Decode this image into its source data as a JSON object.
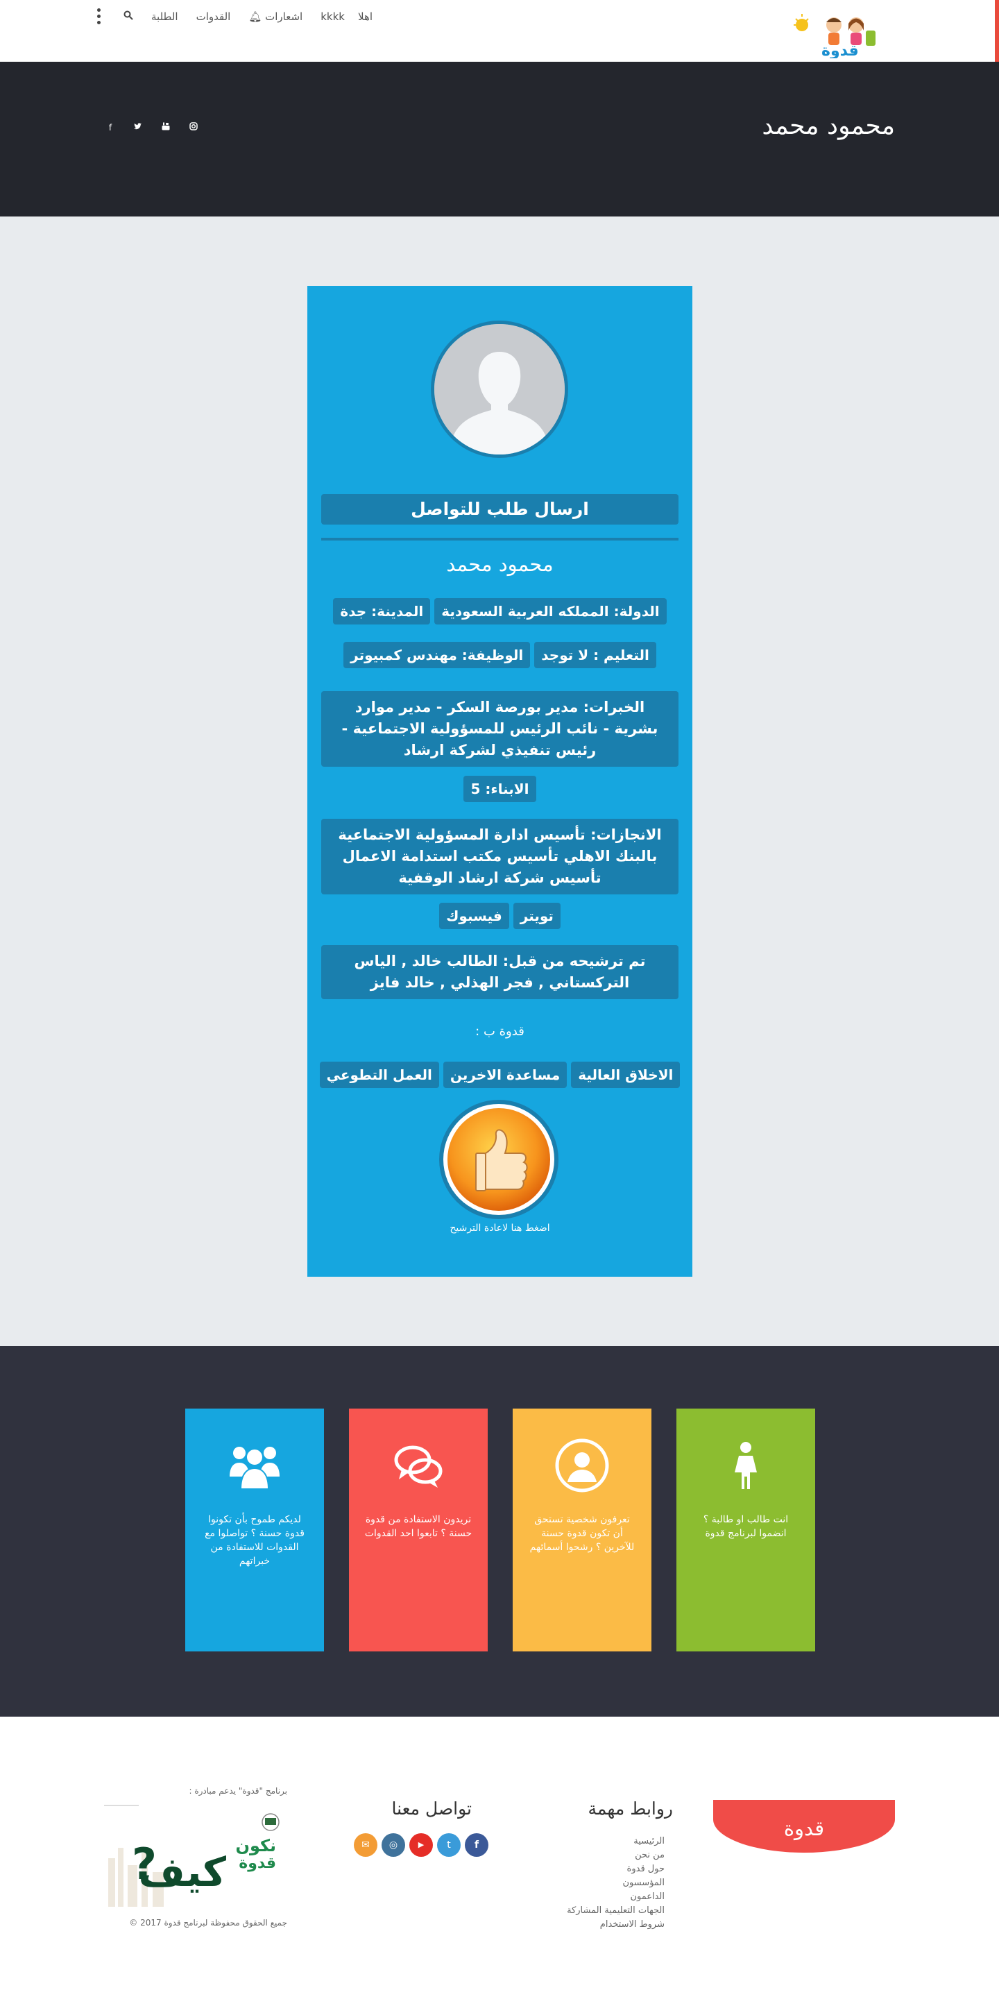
{
  "header": {
    "nav": {
      "search_icon": "search-icon",
      "students": "الطلبة",
      "role_models": "القدوات",
      "notifications": "اشعارات",
      "user_name": "kkkk",
      "greeting": "اهلا"
    },
    "logo_text": "قدوة"
  },
  "banner": {
    "title": "محمود محمد",
    "social_icons": [
      "facebook-icon",
      "twitter-icon",
      "youtube-icon",
      "instagram-icon"
    ]
  },
  "profile": {
    "contact_button": "ارسال طلب للتواصل",
    "name": "محمود محمد",
    "country": "الدولة: المملكه العربية السعودية",
    "city": "المدينة: جدة",
    "education": "التعليم : لا توجد",
    "job": "الوظيفة: مهندس كمبيوتر",
    "experience": "الخبرات: مدير بورصة السكر - مدير موارد بشرية - نائب الرئيس للمسؤولية الاجتماعية - رئيس تنفيذي لشركة ارشاد",
    "children": "الابناء: 5",
    "achievements": "الانجازات: تأسيس ادارة المسؤولية الاجتماعية بالبنك الاهلي تأسيس مكتب استدامة الاعمال تأسيس شركة ارشاد الوقفية",
    "twitter": "تويتر",
    "facebook": "فيسبوك",
    "nominated_by": "تم ترشيحه من قبل: الطالب خالد , الياس التركستاني , فجر الهذلي , خالد فايز",
    "qudwa_label": "قدوة ب :",
    "traits": [
      "الاخلاق العالية",
      "مساعدة الاخرين",
      "العمل التطوعي"
    ],
    "renominate": "اضغط هنا لاعادة الترشيح"
  },
  "tiles": [
    {
      "text": "انت طالب او طالبة ؟ انضموا لبرنامج قدوة",
      "color": "#8cbd30",
      "icon": "student-icon"
    },
    {
      "text": "تعرفون شخصية تستحق أن تكون قدوة حسنة للآخرين ؟ رشحوا أسمائهم",
      "color": "#fbbb46",
      "icon": "person-icon"
    },
    {
      "text": "تريدون الاستفادة من قدوة حسنة ؟ تابعوا احد القدوات",
      "color": "#f85550",
      "icon": "chat-icon"
    },
    {
      "text": "لديكم طموح بأن تكونوا قدوة حسنة ؟ تواصلوا مع القدوات للاستفادة من خبراتهم",
      "color": "#16a6df",
      "icon": "group-icon"
    }
  ],
  "footer": {
    "brand": "قدوة",
    "links_title": "روابط مهمة",
    "links": [
      "الرئيسية",
      "من نحن",
      "حول قدوة",
      "المؤسسون",
      "الداعمون",
      "الجهات التعليمية المشاركة",
      "شروط الاستخدام"
    ],
    "contact_title": "تواصل معنا",
    "social": [
      {
        "icon": "facebook-icon",
        "color": "#3b5998",
        "glyph": "f"
      },
      {
        "icon": "twitter-icon",
        "color": "#3a9bd9",
        "glyph": "t"
      },
      {
        "icon": "youtube-icon",
        "color": "#e52d27",
        "glyph": "▶"
      },
      {
        "icon": "instagram-icon",
        "color": "#3f729b",
        "glyph": "◎"
      },
      {
        "icon": "mail-icon",
        "color": "#f39c35",
        "glyph": "✉"
      }
    ],
    "support_text": "برنامج \"قدوة\" يدعم مبادرة :",
    "initiative_line1": "نكون",
    "initiative_line2": "قدوة",
    "initiative_main": "كيف",
    "copyright": "جميع الحقوق محفوظة لبرنامج قدوة 2017 ©"
  },
  "colors": {
    "card_blue": "#16a6df",
    "chip_blue": "#1a7fae",
    "banner_dark": "#24262d",
    "tiles_dark": "#30323e",
    "brand_red": "#f04c48"
  }
}
